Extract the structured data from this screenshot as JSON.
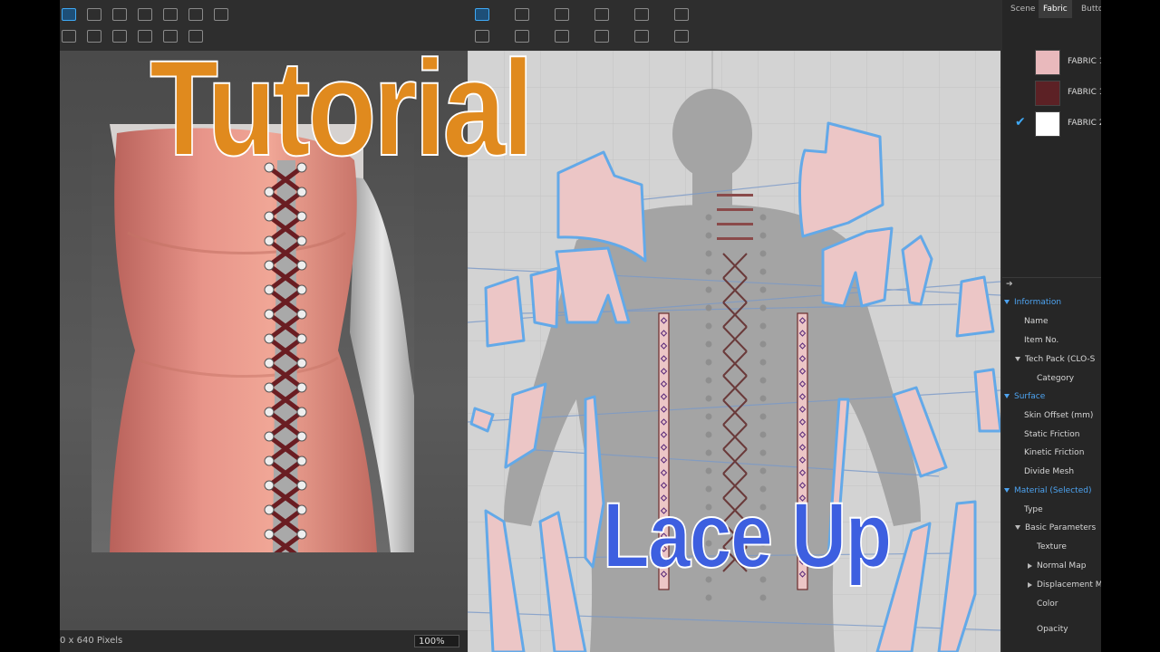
{
  "overlay": {
    "title": "Tutorial",
    "subtitle": "Lace Up",
    "title_color": "#e08a1e",
    "subtitle_color": "#3d5fe0"
  },
  "viewport_3d": {
    "status_resolution": "0 x 640 Pixels",
    "zoom": "100%",
    "toolbar_icons": [
      "simulation-icon",
      "record-icon",
      "camera-icon",
      "screenshot-icon",
      "render-icon",
      "settings-icon",
      "avatar-icon",
      "fabric-icon",
      "cloth-icon",
      "globe-icon",
      "lamp-icon",
      "light-icon",
      "hat-icon"
    ]
  },
  "pattern_window": {
    "toolbar_icons": [
      "transform-pattern-icon",
      "edit-point-icon",
      "polygon-icon",
      "rectangle-icon",
      "internal-polygon-icon",
      "trace-icon",
      "segment-sewing-icon",
      "free-sewing-icon",
      "pin-icon",
      "text-icon",
      "button-icon",
      "topstitch-icon"
    ]
  },
  "right_panel": {
    "tabs": [
      "Scene",
      "Fabric",
      "Butto"
    ],
    "fabrics": [
      {
        "name": "FABRIC 1",
        "color": "#e9b9bc",
        "selected": false
      },
      {
        "name": "FABRIC 1",
        "color": "#5c2125",
        "selected": false
      },
      {
        "name": "FABRIC 2",
        "color": "#ffffff",
        "selected": true
      }
    ],
    "property_editor": [
      {
        "label": "Information",
        "type": "section",
        "indent": 1,
        "arrow": "down"
      },
      {
        "label": "Name",
        "type": "item",
        "indent": 2,
        "arrow": ""
      },
      {
        "label": "Item No.",
        "type": "item",
        "indent": 2,
        "arrow": ""
      },
      {
        "label": "Tech Pack (CLO-S",
        "type": "item",
        "indent": 2,
        "arrow": "down"
      },
      {
        "label": "Category",
        "type": "item",
        "indent": 3,
        "arrow": ""
      },
      {
        "label": "Surface",
        "type": "section",
        "indent": 1,
        "arrow": "down"
      },
      {
        "label": "Skin Offset (mm)",
        "type": "item",
        "indent": 2,
        "arrow": ""
      },
      {
        "label": "Static Friction",
        "type": "item",
        "indent": 2,
        "arrow": ""
      },
      {
        "label": "Kinetic Friction",
        "type": "item",
        "indent": 2,
        "arrow": ""
      },
      {
        "label": "Divide Mesh",
        "type": "item",
        "indent": 2,
        "arrow": ""
      },
      {
        "label": "Material (Selected)",
        "type": "section",
        "indent": 1,
        "arrow": "down"
      },
      {
        "label": "Type",
        "type": "item",
        "indent": 2,
        "arrow": ""
      },
      {
        "label": "Basic Parameters",
        "type": "item",
        "indent": 2,
        "arrow": "down"
      },
      {
        "label": "Texture",
        "type": "item",
        "indent": 3,
        "arrow": ""
      },
      {
        "label": "Normal Map",
        "type": "item",
        "indent": 3,
        "arrow": "right"
      },
      {
        "label": "Displacement M",
        "type": "item",
        "indent": 3,
        "arrow": "right"
      },
      {
        "label": "Color",
        "type": "item",
        "indent": 3,
        "arrow": ""
      },
      {
        "label": "Opacity",
        "type": "item",
        "indent": 3,
        "arrow": ""
      }
    ]
  }
}
